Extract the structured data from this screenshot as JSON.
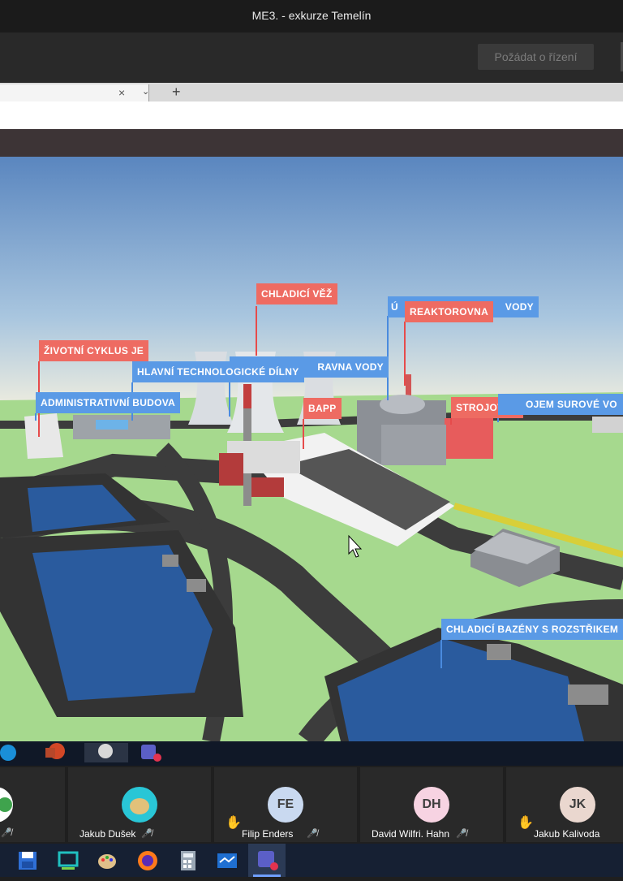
{
  "window": {
    "title": "ME3. - exkurze Temelín"
  },
  "toolbar": {
    "request_control": "Požádat o řízení"
  },
  "browser": {
    "close_glyph": "×",
    "chevron_glyph": "⌄",
    "newtab_glyph": "+"
  },
  "scene": {
    "labels": {
      "chladici_vez": "CHLADICÍ VĚŽ",
      "reaktorovna": "REAKTOROVNA",
      "u_blue": "Ú",
      "vody_blue": "VODY",
      "zivotni_cyklus": "ŽIVOTNÍ CYKLUS JE",
      "hlavni_dilny": "HLAVNÍ TECHNOLOGICKÉ DÍLNY",
      "upravna_vody": "RAVNA VODY",
      "administrativni": "ADMINISTRATIVNÍ BUDOVA",
      "bapp": "BAPP",
      "strojovna": "STROJOVNA",
      "zasobni": "OJEM SUROVÉ VO",
      "chladici_bazeny": "CHLADICÍ BAZÉNY S ROZSTŘIKEM"
    }
  },
  "participants": [
    {
      "name": "",
      "initials": "",
      "muted": true
    },
    {
      "name": "Jakub Dušek",
      "initials": "",
      "muted": true,
      "hand": false
    },
    {
      "name": "Filip Enders",
      "initials": "FE",
      "muted": true,
      "hand": true
    },
    {
      "name": "David Wilfri. Hahn",
      "initials": "DH",
      "muted": true,
      "hand": false
    },
    {
      "name": "Jakub Kalivoda",
      "initials": "JK",
      "muted": false,
      "hand": true
    }
  ],
  "colors": {
    "label_red": "#ee6b62",
    "label_blue": "#5a9ae6",
    "grass": "#a6d98e",
    "water": "#2a5b9e"
  }
}
